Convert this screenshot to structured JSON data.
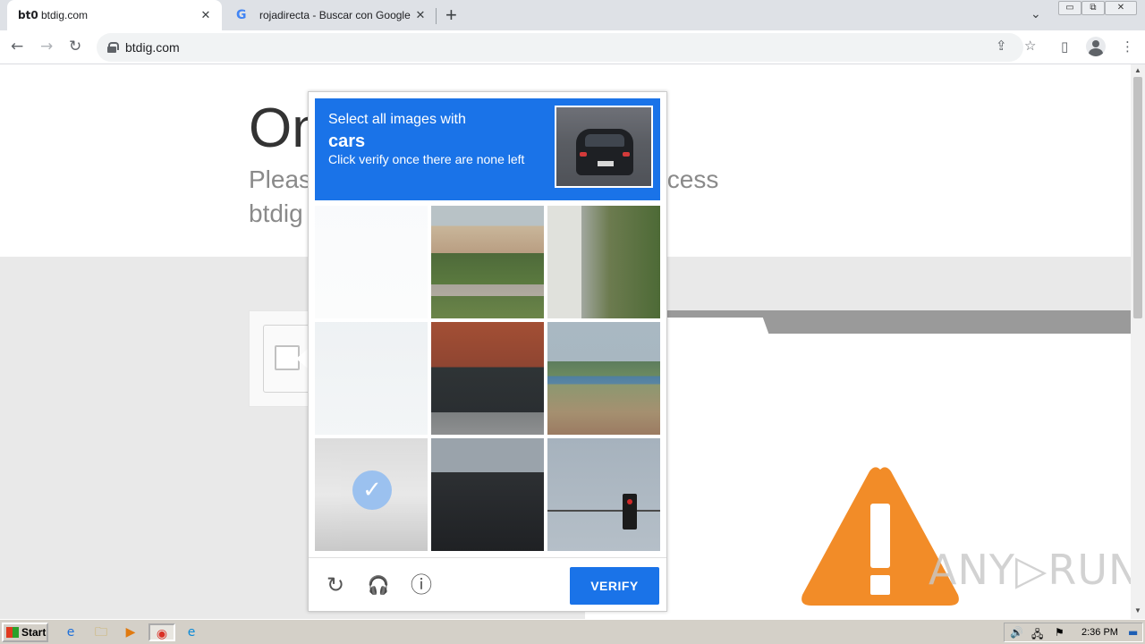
{
  "browser": {
    "tabs": [
      {
        "favicon": "bt0",
        "title": "btdig.com",
        "close": "✕",
        "active": true
      },
      {
        "favicon": "G",
        "title": "rojadirecta - Buscar con Google",
        "close": "✕",
        "active": false
      }
    ],
    "new_tab": "+",
    "tab_search": "⌄",
    "window_buttons": {
      "minimize": "▭",
      "restore": "⧉",
      "close": "✕"
    },
    "nav": {
      "back": "←",
      "forward": "→",
      "reload": "↻"
    },
    "url": "btdig.com",
    "icons": {
      "share": "⇪",
      "bookmark": "☆",
      "sidepanel": "▯",
      "menu": "⋮"
    }
  },
  "page": {
    "heading": "On",
    "subtitle": "Pleas                                        to access btdig",
    "subtitle_left": "Pleas",
    "subtitle_right": "to access",
    "subtitle_line2": "btdig"
  },
  "captcha": {
    "instruction": "Select all images with",
    "target": "cars",
    "hint": "Click verify once there are none left",
    "verify_label": "VERIFY",
    "icons": {
      "reload": "↻",
      "audio": "🎧",
      "info": "ⓘ"
    },
    "tiles": [
      {
        "name": "tile-1",
        "scene": "frost",
        "selected": true
      },
      {
        "name": "tile-2",
        "scene": "house",
        "selected": false
      },
      {
        "name": "tile-3",
        "scene": "palm",
        "selected": false
      },
      {
        "name": "tile-4",
        "scene": "water",
        "selected": true
      },
      {
        "name": "tile-5",
        "scene": "jeep",
        "selected": false
      },
      {
        "name": "tile-6",
        "scene": "shore",
        "selected": false
      },
      {
        "name": "tile-7",
        "scene": "snowcar",
        "selected": true
      },
      {
        "name": "tile-8",
        "scene": "topcar",
        "selected": false
      },
      {
        "name": "tile-9",
        "scene": "light",
        "selected": false
      }
    ]
  },
  "watermark": "ANY▷RUN",
  "taskbar": {
    "start_label": "Start",
    "apps": [
      "e",
      "🗀",
      "▶",
      "◉",
      "e"
    ],
    "clock": "2:36 PM"
  },
  "colors": {
    "captcha_blue": "#1a73e8",
    "warning_orange": "#f28c28"
  }
}
